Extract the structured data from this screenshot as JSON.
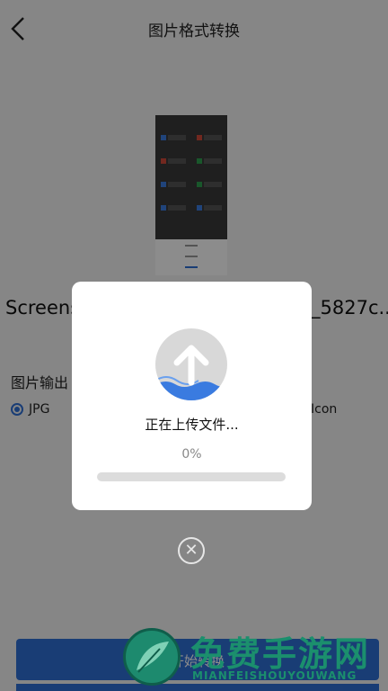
{
  "header": {
    "title": "图片格式转换"
  },
  "file": {
    "name_start": "Screens",
    "name_end": "_5827c.."
  },
  "output": {
    "label": "图片输出",
    "selected": "JPG",
    "other_option": "Icon"
  },
  "start_button": {
    "label": "开始转换"
  },
  "dialog": {
    "message": "正在上传文件...",
    "percent_text": "0%",
    "progress": 0
  },
  "watermark": {
    "text": "免费手游网",
    "sub": "MIANFEISHOUYOUWANG"
  },
  "colors": {
    "accent": "#2f6fd6",
    "wave": "#3a7be0"
  }
}
